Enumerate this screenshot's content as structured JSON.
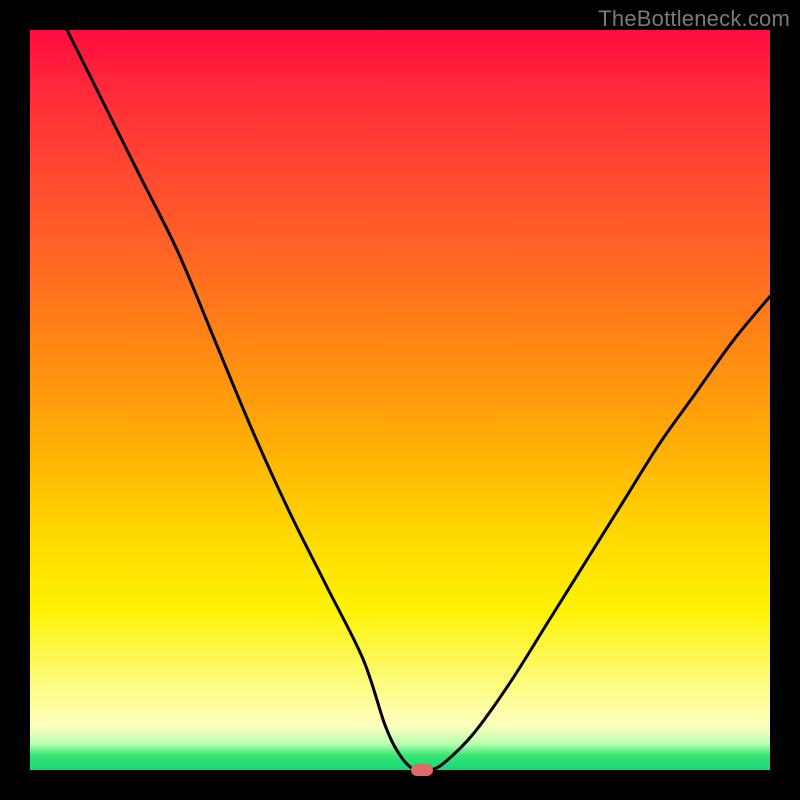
{
  "watermark": {
    "text": "TheBottleneck.com"
  },
  "chart_data": {
    "type": "line",
    "title": "",
    "xlabel": "",
    "ylabel": "",
    "xlim": [
      0,
      100
    ],
    "ylim": [
      0,
      100
    ],
    "grid": false,
    "legend": false,
    "series": [
      {
        "name": "bottleneck-curve",
        "x": [
          5,
          10,
          15,
          20,
          25,
          30,
          35,
          40,
          45,
          48,
          50,
          52,
          54,
          56,
          60,
          65,
          70,
          75,
          80,
          85,
          90,
          95,
          100
        ],
        "values": [
          100,
          90,
          80,
          70,
          58,
          46,
          35,
          25,
          15,
          6,
          2,
          0,
          0,
          1,
          5,
          12,
          20,
          28,
          36,
          44,
          51,
          58,
          64
        ]
      }
    ],
    "marker": {
      "x": 53,
      "y": 0,
      "color": "#e06a6a",
      "shape": "pill"
    },
    "background_gradient": {
      "stops": [
        {
          "pos": 0.0,
          "color": "#ff0b40"
        },
        {
          "pos": 0.32,
          "color": "#ff6a22"
        },
        {
          "pos": 0.68,
          "color": "#ffd800"
        },
        {
          "pos": 0.94,
          "color": "#feffbf"
        },
        {
          "pos": 0.98,
          "color": "#36e673"
        },
        {
          "pos": 1.0,
          "color": "#18d879"
        }
      ]
    }
  }
}
